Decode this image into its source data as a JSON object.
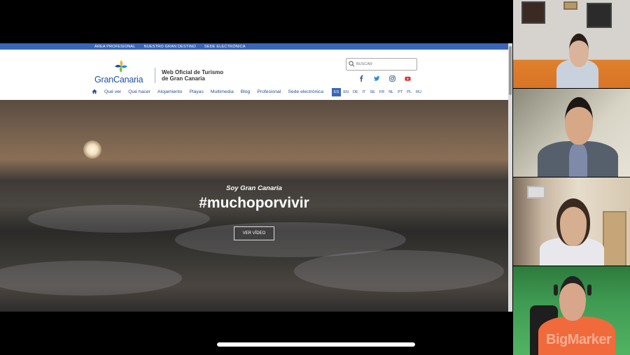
{
  "topbar": {
    "links": [
      "ÁREA PROFESIONAL",
      "NUESTRO GRAN DESTINO",
      "SEDE ELECTRÓNICA"
    ]
  },
  "header": {
    "logo_text": "GranCanaria",
    "site_title_line1": "Web Oficial de Turismo",
    "site_title_line2": "de Gran Canaria",
    "search_placeholder": "BUSCAR"
  },
  "social": [
    "facebook-icon",
    "twitter-icon",
    "instagram-icon",
    "youtube-icon"
  ],
  "nav": {
    "items": [
      "Qué ver",
      "Qué hacer",
      "Alojamiento",
      "Playas",
      "Multimedia",
      "Blog",
      "Profesional",
      "Sede electrónica"
    ]
  },
  "langs": {
    "items": [
      "ES",
      "EN",
      "DE",
      "IT",
      "SE",
      "FR",
      "NL",
      "PT",
      "PL",
      "RU"
    ],
    "active": "ES"
  },
  "hero": {
    "subtitle": "Soy Gran Canaria",
    "title": "#muchoporvivir",
    "button": "VER VÍDEO"
  },
  "watermark": "BigMarker",
  "colors": {
    "topbar": "#3a66b8",
    "brand_blue": "#1f4fa8",
    "nav_text": "#2a4d8f"
  }
}
